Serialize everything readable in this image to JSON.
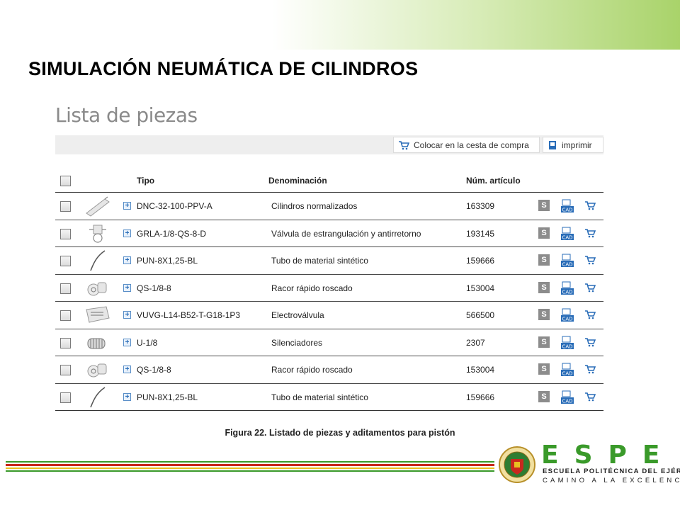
{
  "slide": {
    "title": "SIMULACIÓN NEUMÁTICA DE CILINDROS",
    "caption": "Figura 22. Listado de piezas y aditamentos para pistón"
  },
  "app": {
    "title": "Lista de piezas",
    "toolbar": {
      "cart_label": "Colocar en la cesta de compra",
      "print_label": "imprimir"
    },
    "columns": {
      "tipo": "Tipo",
      "denominacion": "Denominación",
      "num": "Núm. artículo"
    },
    "rows": [
      {
        "tipo": "DNC-32-100-PPV-A",
        "denominacion": "Cilindros normalizados",
        "num": "163309",
        "icon": "cylinder-icon"
      },
      {
        "tipo": "GRLA-1/8-QS-8-D",
        "denominacion": "Válvula de estrangulación y antirretorno",
        "num": "193145",
        "icon": "flow-valve-icon"
      },
      {
        "tipo": "PUN-8X1,25-BL",
        "denominacion": "Tubo de material sintético",
        "num": "159666",
        "icon": "tube-icon"
      },
      {
        "tipo": "QS-1/8-8",
        "denominacion": "Racor rápido roscado",
        "num": "153004",
        "icon": "fitting-icon"
      },
      {
        "tipo": "VUVG-L14-B52-T-G18-1P3",
        "denominacion": "Electroválvula",
        "num": "566500",
        "icon": "solenoid-valve-icon"
      },
      {
        "tipo": "U-1/8",
        "denominacion": "Silenciadores",
        "num": "2307",
        "icon": "silencer-icon"
      },
      {
        "tipo": "QS-1/8-8",
        "denominacion": "Racor rápido roscado",
        "num": "153004",
        "icon": "fitting-icon"
      },
      {
        "tipo": "PUN-8X1,25-BL",
        "denominacion": "Tubo de material sintético",
        "num": "159666",
        "icon": "tube-icon"
      }
    ],
    "actions": {
      "s_label": "S",
      "cad_label": "CAD"
    }
  },
  "logo": {
    "letters": "ESPE",
    "line1": "ESCUELA POLITÉCNICA DEL EJÉRCITO",
    "line2": "CAMINO A LA EXCELENCIA"
  },
  "colors": {
    "accent_green": "#3a9a2a",
    "stripe_red": "#c8281e",
    "stripe_yellow": "#e8c020",
    "header_gradient_end": "#a9d36a"
  }
}
